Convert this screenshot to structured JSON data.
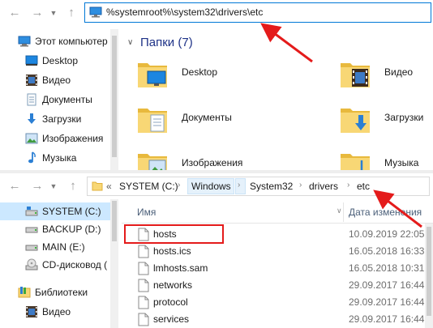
{
  "top_window": {
    "address_path": "%systemroot%\\system32\\drivers\\etc",
    "sidebar": [
      {
        "label": "Этот компьютер",
        "icon": "computer-icon"
      },
      {
        "label": "Desktop",
        "icon": "desktop-icon"
      },
      {
        "label": "Видео",
        "icon": "video-icon"
      },
      {
        "label": "Документы",
        "icon": "documents-icon"
      },
      {
        "label": "Загрузки",
        "icon": "downloads-icon"
      },
      {
        "label": "Изображения",
        "icon": "pictures-icon"
      },
      {
        "label": "Музыка",
        "icon": "music-icon"
      }
    ],
    "section_title": "Папки (7)",
    "folders": [
      {
        "label": "Desktop",
        "icon": "desktop-folder-icon"
      },
      {
        "label": "Видео",
        "icon": "video-folder-icon"
      },
      {
        "label": "Документы",
        "icon": "documents-folder-icon"
      },
      {
        "label": "Загрузки",
        "icon": "downloads-folder-icon"
      },
      {
        "label": "Изображения",
        "icon": "pictures-folder-icon"
      },
      {
        "label": "Музыка",
        "icon": "music-folder-icon"
      }
    ]
  },
  "bottom_window": {
    "breadcrumb_prefix": "«",
    "breadcrumbs": [
      "SYSTEM (C:)",
      "Windows",
      "System32",
      "drivers",
      "etc"
    ],
    "sidebar": [
      {
        "label": "SYSTEM (C:)",
        "icon": "system-drive-icon",
        "selected": true
      },
      {
        "label": "BACKUP (D:)",
        "icon": "drive-icon"
      },
      {
        "label": "MAIN (E:)",
        "icon": "drive-icon"
      },
      {
        "label": "CD-дисковод (",
        "icon": "cd-drive-icon"
      },
      {
        "label": "Библиотеки",
        "icon": "libraries-icon"
      },
      {
        "label": "Видео",
        "icon": "video-icon"
      }
    ],
    "columns": {
      "name": "Имя",
      "date": "Дата изменения"
    },
    "files": [
      {
        "name": "hosts",
        "date": "10.09.2019 22:05",
        "icon": "file-icon"
      },
      {
        "name": "hosts.ics",
        "date": "16.05.2018 16:33",
        "icon": "file-icon"
      },
      {
        "name": "lmhosts.sam",
        "date": "16.05.2018 10:31",
        "icon": "file-icon"
      },
      {
        "name": "networks",
        "date": "29.09.2017 16:44",
        "icon": "file-icon"
      },
      {
        "name": "protocol",
        "date": "29.09.2017 16:44",
        "icon": "file-icon"
      },
      {
        "name": "services",
        "date": "29.09.2017 16:44",
        "icon": "file-icon"
      }
    ]
  },
  "colors": {
    "annotation_red": "#e41b1b",
    "folder_yellow": "#f8d775",
    "section_blue": "#1e3287",
    "selection_blue": "#cce8ff"
  }
}
